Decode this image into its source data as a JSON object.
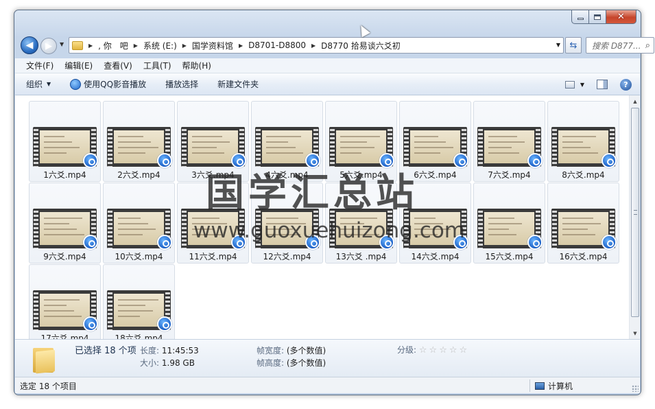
{
  "window": {
    "caption": {
      "minimize": "—",
      "maximize": "□",
      "close": "✕"
    }
  },
  "nav": {
    "back": "◀",
    "forward": "▶",
    "breadcrumb": [
      ", 你　吧",
      "系统 (E:)",
      "国学资料馆",
      "D8701-D8800",
      "D8770 拾易谈六爻初"
    ],
    "search_placeholder": "搜索 D877..."
  },
  "menu": [
    "文件(F)",
    "编辑(E)",
    "查看(V)",
    "工具(T)",
    "帮助(H)"
  ],
  "commands": {
    "organize": "组织",
    "qq_play": "使用QQ影音播放",
    "play_selection": "播放选择",
    "new_folder": "新建文件夹"
  },
  "files": [
    "1六爻.mp4",
    "2六爻.mp4",
    "3六爻.mp4",
    "4六爻.mp4",
    "5六爻.mp4",
    "6六爻.mp4",
    "7六爻.mp4",
    "8六爻.mp4",
    "9六爻.mp4",
    "10六爻.mp4",
    "11六爻.mp4",
    "12六爻.mp4",
    "13六爻 .mp4",
    "14六爻.mp4",
    "15六爻.mp4",
    "16六爻.mp4",
    "17六爻.mp4",
    "18六爻.mp4"
  ],
  "details": {
    "selected": "已选择 18 个项",
    "length_label": "长度:",
    "length_value": "11:45:53",
    "size_label": "大小:",
    "size_value": "1.98 GB",
    "frame_width_label": "帧宽度:",
    "frame_width_value": "(多个数值)",
    "frame_height_label": "帧高度:",
    "frame_height_value": "(多个数值)",
    "rating_label": "分级:"
  },
  "status": {
    "left": "选定 18 个项目",
    "right": "计算机"
  },
  "watermark": {
    "title": "国学汇总站",
    "url": "www.guoxuehuizong.com"
  },
  "colors": {
    "accent": "#1a5fc6",
    "window_frame": "#bfd0e6"
  }
}
